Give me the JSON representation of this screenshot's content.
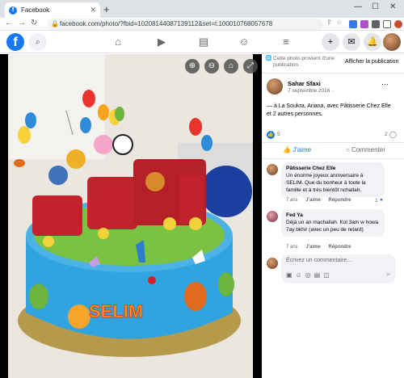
{
  "browser": {
    "tab_title": "Facebook",
    "url": "facebook.com/photo/?fbid=1020814408713911​2&set=t.100010768057678",
    "new_tab": "+",
    "minimize": "—",
    "maximize": "☐",
    "close": "✕"
  },
  "panel": {
    "notice": "Cette photo provient d'une publication.",
    "view_post": "Afficher la publication",
    "author": "Sahar Sfaxi",
    "date": "7 septembre 2016 ·",
    "more": "···",
    "caption": "— à La Soukra, Ariana, avec Pâtisserie Chez Elle et 2 autres personnes.",
    "likes": "5",
    "comment_count": "2",
    "like_label": "J'aime",
    "comment_label": "Commenter",
    "comments": [
      {
        "name": "Pâtisserie Chez Elle",
        "text": "Un énorme joyeux anniversaire à SELIM. Que du bonheur à toute la famille et à très bientôt nchallah.",
        "age": "7 ans",
        "like": "J'aime",
        "reply": "Répondre",
        "reactions": "1"
      },
      {
        "name": "Fed Ya",
        "text": "Déjà un an machallah. Kol 3am w howa 7ay bkhir (avec un peu de retard)",
        "age": "7 ans",
        "like": "J'aime",
        "reply": "Répondre"
      }
    ],
    "comment_placeholder": "Écrivez un commentaire…"
  },
  "photo": {
    "cake_name": "SELIM"
  },
  "colors": {
    "brand": "#1877f2",
    "cake_blue": "#2fa4e0",
    "train_red": "#c0232b",
    "grass": "#7cc242"
  }
}
